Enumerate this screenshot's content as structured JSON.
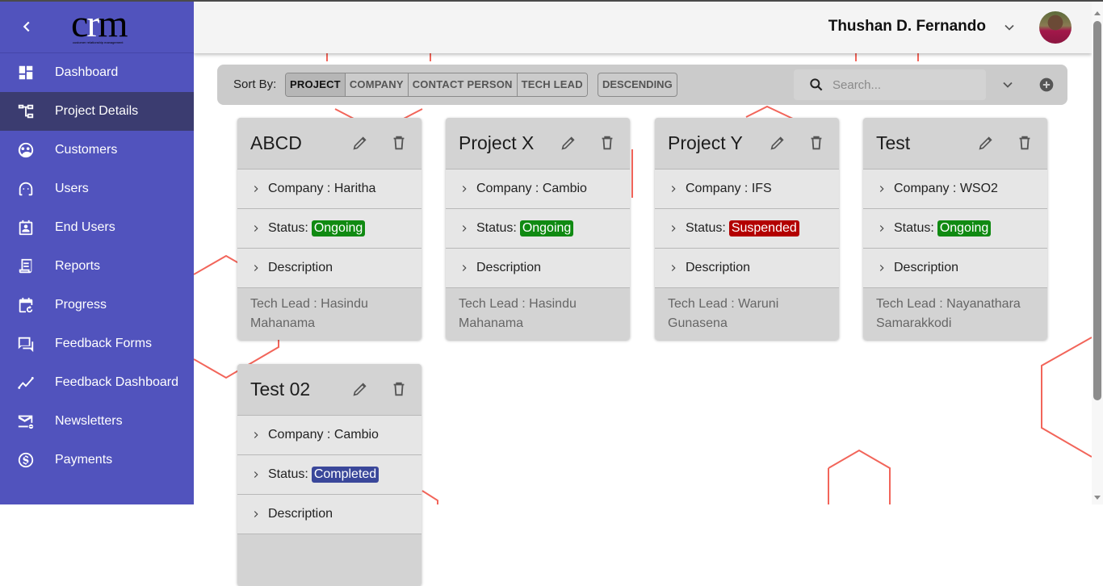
{
  "app": {
    "logo_text_c": "c",
    "logo_text_r": "r",
    "logo_text_m": "m",
    "logo_tagline": "customer relationship management"
  },
  "sidebar": {
    "items": [
      {
        "label": "Dashboard",
        "icon": "dashboard-icon",
        "active": false
      },
      {
        "label": "Project Details",
        "icon": "project-tree-icon",
        "active": true
      },
      {
        "label": "Customers",
        "icon": "customers-icon",
        "active": false
      },
      {
        "label": "Users",
        "icon": "users-headset-icon",
        "active": false
      },
      {
        "label": "End Users",
        "icon": "end-user-badge-icon",
        "active": false
      },
      {
        "label": "Reports",
        "icon": "reports-icon",
        "active": false
      },
      {
        "label": "Progress",
        "icon": "calendar-progress-icon",
        "active": false
      },
      {
        "label": "Feedback Forms",
        "icon": "feedback-forms-icon",
        "active": false
      },
      {
        "label": "Feedback Dashboard",
        "icon": "trend-line-icon",
        "active": false
      },
      {
        "label": "Newsletters",
        "icon": "mail-icon",
        "active": false
      },
      {
        "label": "Payments",
        "icon": "dollar-circle-icon",
        "active": false
      }
    ]
  },
  "header": {
    "user_name": "Thushan D. Fernando"
  },
  "toolbar": {
    "sort_label": "Sort By:",
    "sort_options": [
      "PROJECT",
      "COMPANY",
      "CONTACT PERSON",
      "TECH LEAD"
    ],
    "active_sort": "PROJECT",
    "order_label": "DESCENDING",
    "search_placeholder": "Search...",
    "search_value": ""
  },
  "status_colors": {
    "Ongoing": "#108a12",
    "Suspended": "#b30000",
    "Completed": "#3a479a"
  },
  "projects": [
    {
      "title": "ABCD",
      "company_label": "Company : Haritha",
      "status_label": "Status:",
      "status": "Ongoing",
      "description_label": "Description",
      "tech_lead": "Tech Lead : Hasindu Mahanama"
    },
    {
      "title": "Project X",
      "company_label": "Company : Cambio",
      "status_label": "Status:",
      "status": "Ongoing",
      "description_label": "Description",
      "tech_lead": "Tech Lead : Hasindu Mahanama"
    },
    {
      "title": "Project Y",
      "company_label": "Company : IFS",
      "status_label": "Status:",
      "status": "Suspended",
      "description_label": "Description",
      "tech_lead": "Tech Lead : Waruni Gunasena"
    },
    {
      "title": "Test",
      "company_label": "Company : WSO2",
      "status_label": "Status:",
      "status": "Ongoing",
      "description_label": "Description",
      "tech_lead": "Tech Lead : Nayanathara Samarakkodi"
    },
    {
      "title": "Test 02",
      "company_label": "Company : Cambio",
      "status_label": "Status:",
      "status": "Completed",
      "description_label": "Description",
      "tech_lead": ""
    }
  ]
}
